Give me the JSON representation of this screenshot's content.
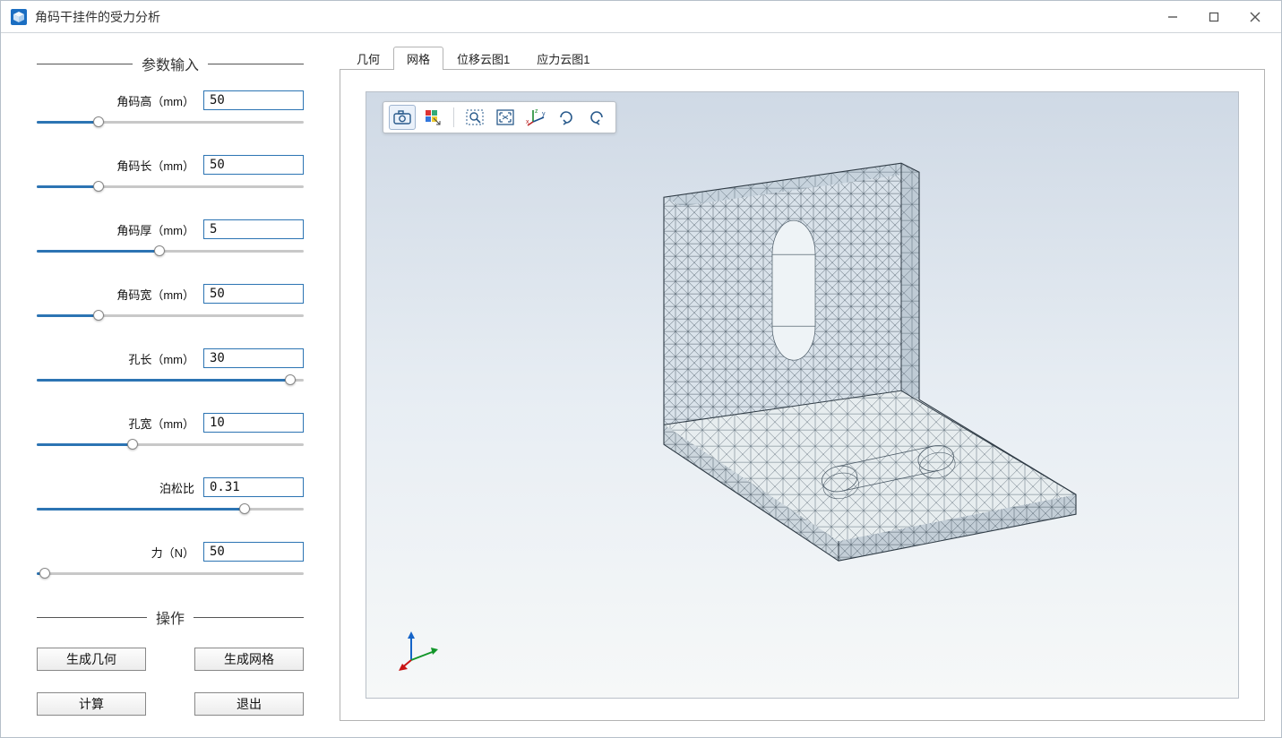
{
  "window": {
    "title": "角码干挂件的受力分析"
  },
  "sections": {
    "params_header": "参数输入",
    "actions_header": "操作"
  },
  "params": [
    {
      "label": "角码高（mm）",
      "value": "50",
      "fill_pct": 23
    },
    {
      "label": "角码长（mm）",
      "value": "50",
      "fill_pct": 23
    },
    {
      "label": "角码厚（mm）",
      "value": "5",
      "fill_pct": 46
    },
    {
      "label": "角码宽（mm）",
      "value": "50",
      "fill_pct": 23
    },
    {
      "label": "孔长（mm）",
      "value": "30",
      "fill_pct": 95
    },
    {
      "label": "孔宽（mm）",
      "value": "10",
      "fill_pct": 36
    },
    {
      "label": "泊松比",
      "value": "0.31",
      "fill_pct": 78
    },
    {
      "label": "力（N）",
      "value": "50",
      "fill_pct": 3
    }
  ],
  "buttons": {
    "gen_geometry": "生成几何",
    "gen_mesh": "生成网格",
    "compute": "计算",
    "exit": "退出"
  },
  "tabs": [
    {
      "label": "几何",
      "active": false
    },
    {
      "label": "网格",
      "active": true
    },
    {
      "label": "位移云图1",
      "active": false
    },
    {
      "label": "应力云图1",
      "active": false
    }
  ],
  "view_toolbar": {
    "icons": [
      "camera-icon",
      "selection-mode-icon",
      "zoom-box-icon",
      "zoom-extents-icon",
      "axes-icon",
      "rotate-cw-icon",
      "rotate-ccw-icon"
    ]
  }
}
